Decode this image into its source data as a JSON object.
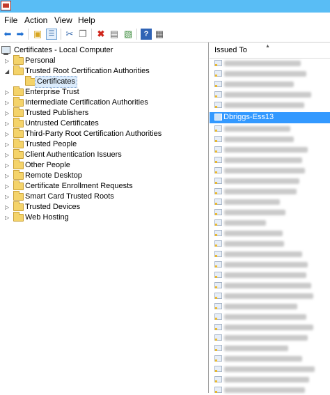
{
  "menu": {
    "items": [
      "File",
      "Action",
      "View",
      "Help"
    ]
  },
  "toolbar": {
    "buttons": [
      "back-icon",
      "forward-icon",
      "up-folder-icon",
      "show-hide-tree-icon",
      "cut-icon",
      "copy-icon",
      "delete-icon",
      "properties-icon",
      "export-icon",
      "help-icon",
      "console-icon"
    ]
  },
  "tree": {
    "root_label": "Certificates - Local Computer",
    "items": [
      {
        "label": "Personal"
      },
      {
        "label": "Trusted Root Certification Authorities"
      },
      {
        "label": "Certificates"
      },
      {
        "label": "Enterprise Trust"
      },
      {
        "label": "Intermediate Certification Authorities"
      },
      {
        "label": "Trusted Publishers"
      },
      {
        "label": "Untrusted Certificates"
      },
      {
        "label": "Third-Party Root Certification Authorities"
      },
      {
        "label": "Trusted People"
      },
      {
        "label": "Client Authentication Issuers"
      },
      {
        "label": "Other People"
      },
      {
        "label": "Remote Desktop"
      },
      {
        "label": "Certificate Enrollment Requests"
      },
      {
        "label": "Smart Card Trusted Roots"
      },
      {
        "label": "Trusted Devices"
      },
      {
        "label": "Web Hosting"
      }
    ]
  },
  "list": {
    "column_header": "Issued To",
    "highlighted_item": "Dbriggs-Ess13"
  },
  "colors": {
    "titlebar": "#59bdf5",
    "selection": "#3399ff",
    "folder": "#f4d36a"
  }
}
